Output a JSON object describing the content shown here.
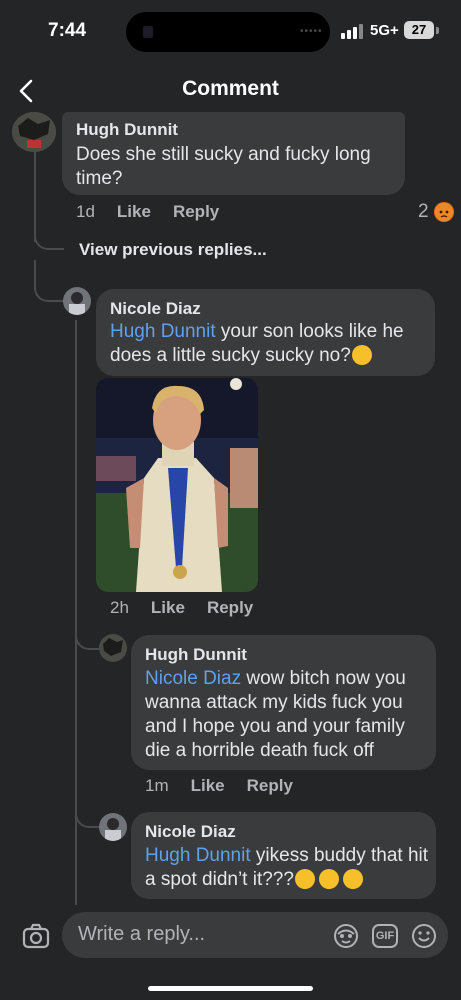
{
  "status": {
    "time": "7:44",
    "network": "5G+",
    "battery": "27"
  },
  "header": {
    "title": "Comment"
  },
  "comment1": {
    "author": "Hugh Dunnit",
    "text": "Does she still sucky and fucky long time?",
    "time": "1d",
    "like": "Like",
    "reply": "Reply",
    "reaction_count": "2"
  },
  "view_previous": "View previous replies...",
  "comment2": {
    "author": "Nicole Diaz",
    "mention": "Hugh Dunnit",
    "text": " your son looks like he does a little sucky sucky no?",
    "time": "2h",
    "like": "Like",
    "reply": "Reply"
  },
  "comment3": {
    "author": "Hugh Dunnit",
    "mention": "Nicole Diaz",
    "text": " wow bitch now you wanna attack my kids fuck you and I hope you and your family die a horrible death fuck off",
    "time": "1m",
    "like": "Like",
    "reply": "Reply"
  },
  "comment4": {
    "author": "Nicole Diaz",
    "mention": "Hugh Dunnit",
    "text": " yikess buddy that hit a spot didn’t it???"
  },
  "composer": {
    "placeholder": "Write a reply...",
    "gif_label": "GIF"
  },
  "icons": [
    "back-arrow-icon",
    "camera-icon",
    "sticker-icon",
    "gif-icon",
    "emoji-icon"
  ],
  "colors": {
    "background": "#242526",
    "bubble": "#3a3b3c",
    "mention": "#5ea1f0",
    "angry": "#e9710f"
  }
}
